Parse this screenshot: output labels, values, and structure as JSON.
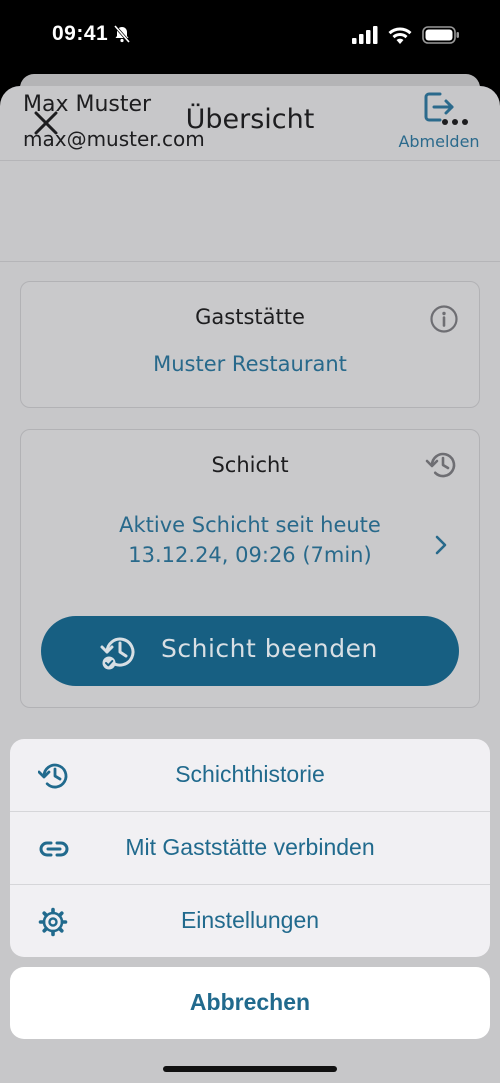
{
  "status_bar": {
    "time": "09:41"
  },
  "nav": {
    "title": "Übersicht"
  },
  "user": {
    "name": "Max Muster",
    "email": "max@muster.com",
    "logout_label": "Abmelden"
  },
  "restaurant_card": {
    "title": "Gaststätte",
    "name": "Muster Restaurant"
  },
  "shift_card": {
    "title": "Schicht",
    "active_line1": "Aktive Schicht seit heute",
    "active_line2": "13.12.24, 09:26 (7min)",
    "end_button_label": "Schicht beenden"
  },
  "action_sheet": {
    "items": [
      {
        "label": "Schichthistorie",
        "icon": "history-icon"
      },
      {
        "label": "Mit Gaststätte verbinden",
        "icon": "link-icon"
      },
      {
        "label": "Einstellungen",
        "icon": "gear-icon"
      }
    ],
    "cancel_label": "Abbrechen"
  },
  "colors": {
    "accent": "#216a8d",
    "primary_button": "#175f82",
    "sheet_background": "#c7c7c9"
  }
}
